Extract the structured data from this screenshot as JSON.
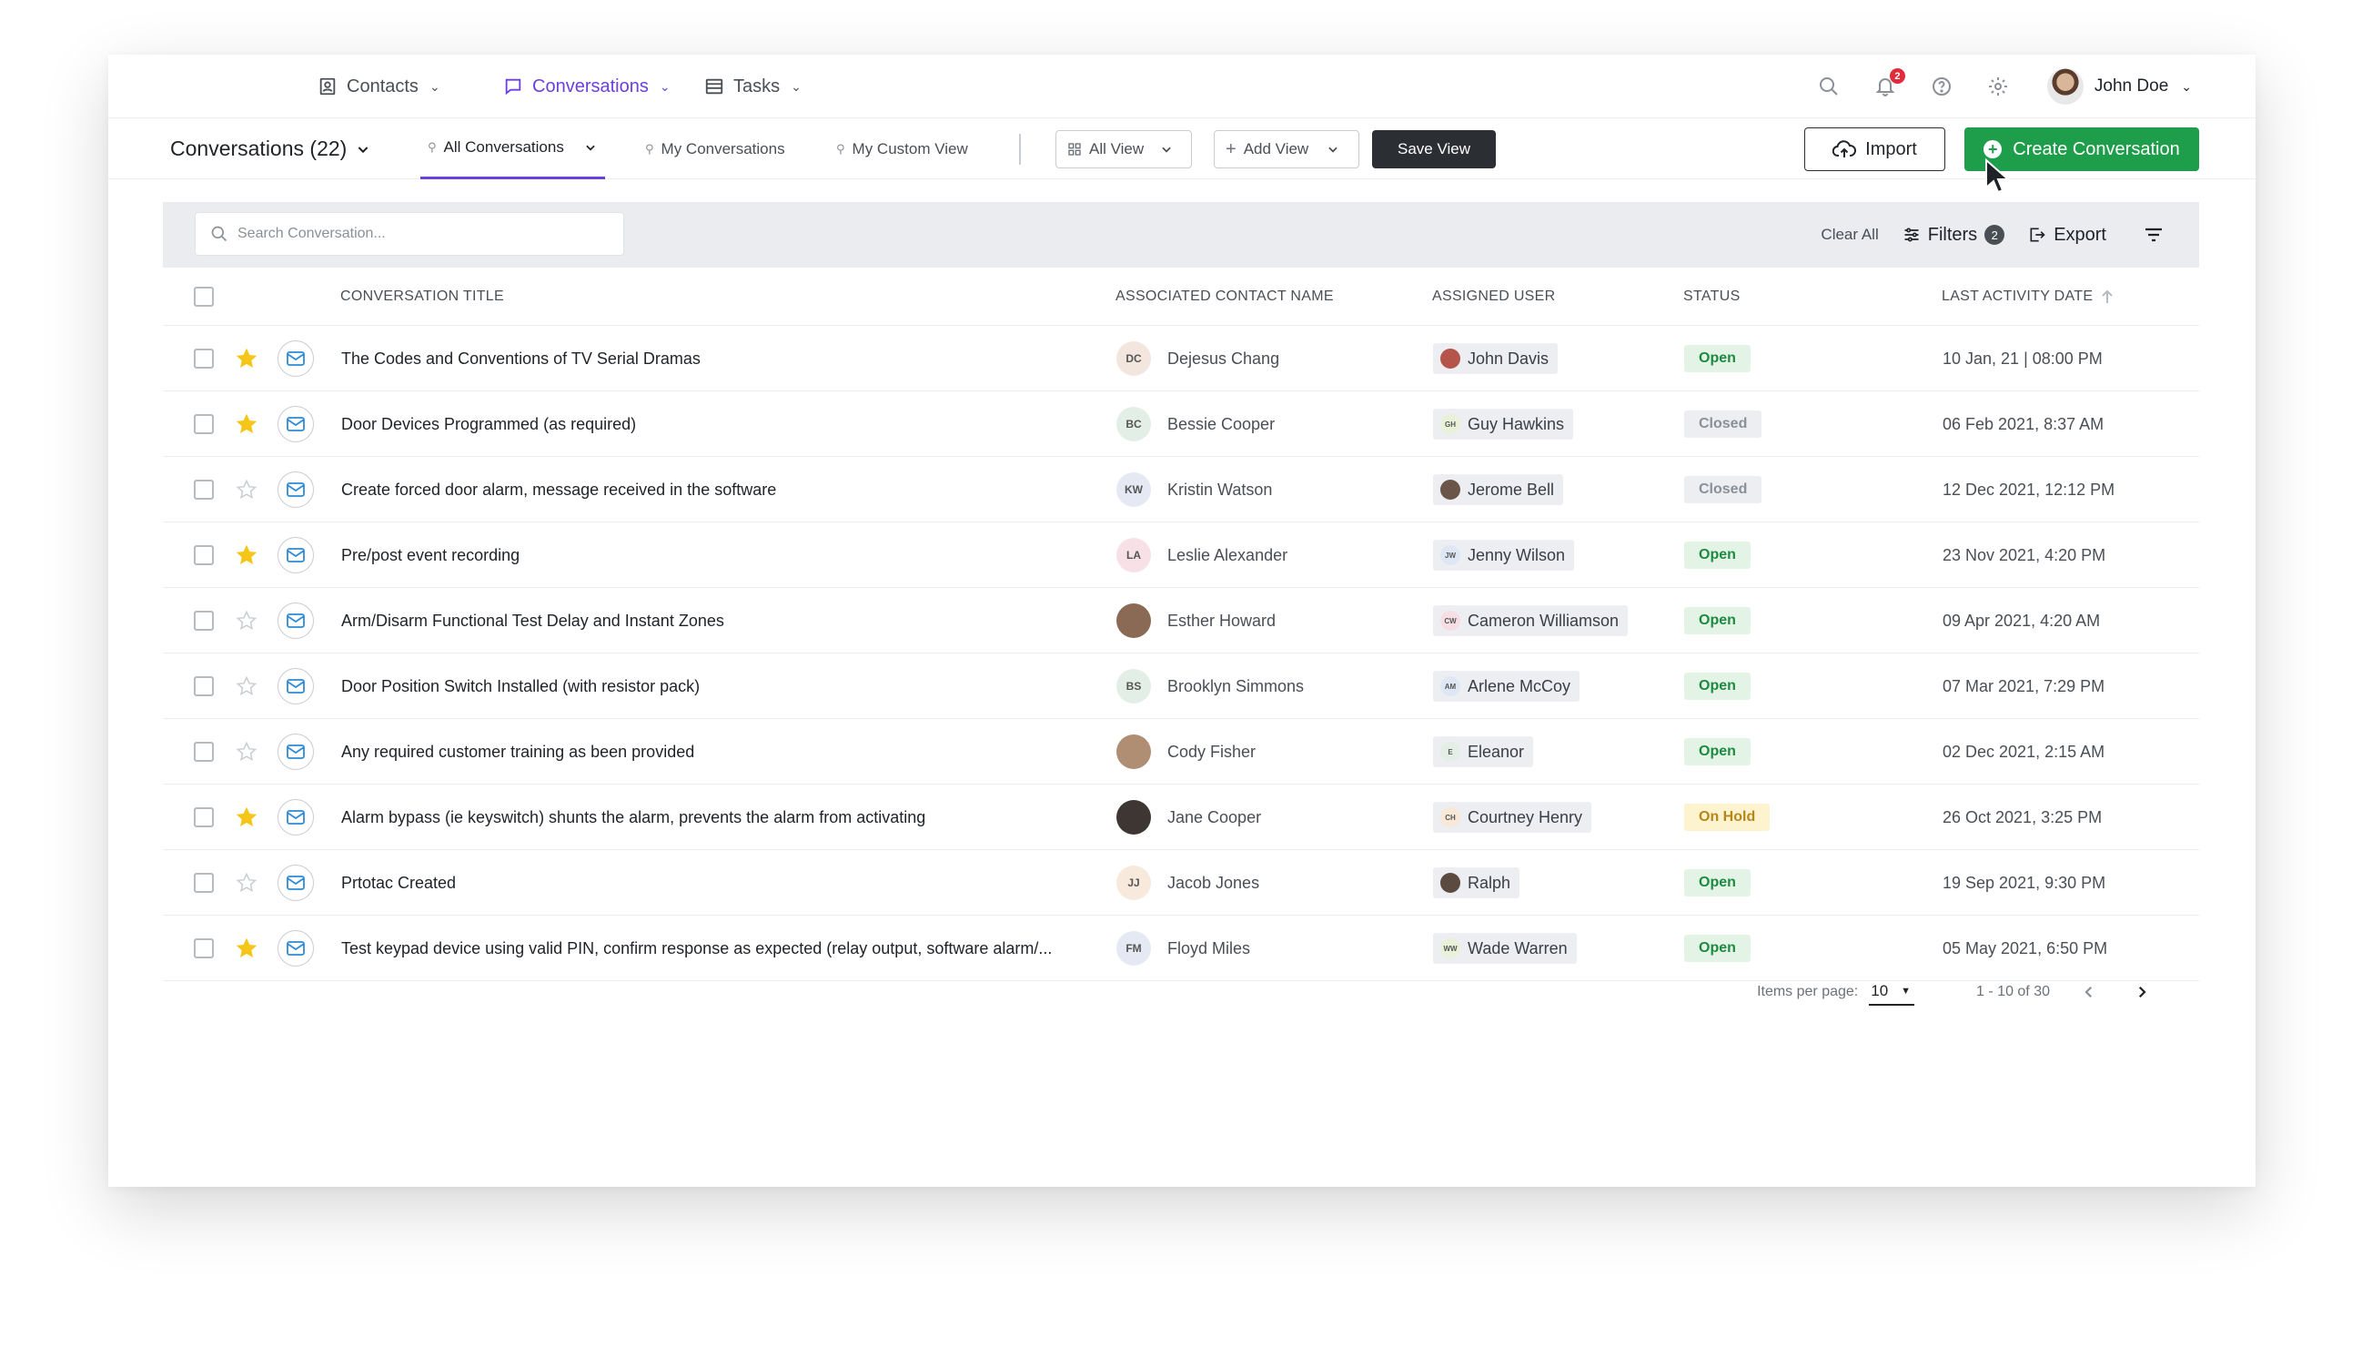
{
  "nav": {
    "items": [
      {
        "label": "Contacts",
        "icon": "contacts-icon",
        "active": false
      },
      {
        "label": "Conversations",
        "icon": "chat-icon",
        "active": true
      },
      {
        "label": "Tasks",
        "icon": "tasks-icon",
        "active": false
      }
    ],
    "notification_count": "2",
    "user_name": "John Doe"
  },
  "subheader": {
    "title": "Conversations (22)",
    "tabs": [
      {
        "label": "All Conversations",
        "active": true
      },
      {
        "label": "My Conversations",
        "active": false
      },
      {
        "label": "My Custom View",
        "active": false
      }
    ],
    "all_view_label": "All View",
    "add_view_label": "Add View",
    "save_view_label": "Save View",
    "import_label": "Import",
    "create_label": "Create Conversation"
  },
  "toolbar": {
    "search_placeholder": "Search Conversation...",
    "clear_all": "Clear All",
    "filters_label": "Filters",
    "filters_count": "2",
    "export_label": "Export"
  },
  "table": {
    "columns": {
      "title": "CONVERSATION TITLE",
      "contact": "ASSOCIATED CONTACT NAME",
      "user": "ASSIGNED USER",
      "status": "STATUS",
      "date": "LAST ACTIVITY DATE"
    },
    "rows": [
      {
        "starred": true,
        "title": "The Codes and Conventions of TV Serial Dramas",
        "contact_initials": "DC",
        "contact": "Dejesus Chang",
        "contact_avatar_color": "#f3e6df",
        "user_initials": "",
        "user": "John Davis",
        "user_avatar_color": "#b5544a",
        "status": "Open",
        "date": "10 Jan, 21 | 08:00 PM"
      },
      {
        "starred": true,
        "title": "Door Devices Programmed (as required)",
        "contact_initials": "BC",
        "contact": "Bessie Cooper",
        "contact_avatar_color": "#e3efe6",
        "user_initials": "GH",
        "user": "Guy Hawkins",
        "user_avatar_color": "#e9f1d9",
        "status": "Closed",
        "date": "06 Feb 2021, 8:37 AM"
      },
      {
        "starred": false,
        "title": "Create forced door alarm, message received in the software",
        "contact_initials": "KW",
        "contact": "Kristin Watson",
        "contact_avatar_color": "#e4e9f4",
        "user_initials": "",
        "user": "Jerome Bell",
        "user_avatar_color": "#6a5548",
        "status": "Closed",
        "date": "12 Dec 2021, 12:12 PM"
      },
      {
        "starred": true,
        "title": "Pre/post event recording",
        "contact_initials": "LA",
        "contact": "Leslie Alexander",
        "contact_avatar_color": "#f7e1e6",
        "user_initials": "JW",
        "user": "Jenny Wilson",
        "user_avatar_color": "#dfe6f4",
        "status": "Open",
        "date": "23 Nov 2021, 4:20 PM"
      },
      {
        "starred": false,
        "title": "Arm/Disarm Functional Test Delay and Instant Zones",
        "contact_initials": "",
        "contact": "Esther Howard",
        "contact_avatar_color": "#8a6a55",
        "user_initials": "CW",
        "user": "Cameron Williamson",
        "user_avatar_color": "#f6dfe4",
        "status": "Open",
        "date": "09 Apr 2021, 4:20 AM"
      },
      {
        "starred": false,
        "title": "Door Position Switch Installed (with resistor pack)",
        "contact_initials": "BS",
        "contact": "Brooklyn Simmons",
        "contact_avatar_color": "#e3efe6",
        "user_initials": "AM",
        "user": "Arlene McCoy",
        "user_avatar_color": "#dfe6f4",
        "status": "Open",
        "date": "07 Mar 2021, 7:29 PM"
      },
      {
        "starred": false,
        "title": "Any required customer training as been provided",
        "contact_initials": "",
        "contact": "Cody Fisher",
        "contact_avatar_color": "#b08e74",
        "user_initials": "E",
        "user": "Eleanor",
        "user_avatar_color": "#e3efe6",
        "status": "Open",
        "date": "02 Dec 2021, 2:15 AM"
      },
      {
        "starred": true,
        "title": "Alarm bypass (ie keyswitch) shunts the alarm, prevents the alarm from activating",
        "contact_initials": "",
        "contact": "Jane Cooper",
        "contact_avatar_color": "#3d3633",
        "user_initials": "CH",
        "user": "Courtney Henry",
        "user_avatar_color": "#f7e8d8",
        "status": "On Hold",
        "date": "26 Oct 2021, 3:25 PM"
      },
      {
        "starred": false,
        "title": "Prtotac Created",
        "contact_initials": "JJ",
        "contact": "Jacob Jones",
        "contact_avatar_color": "#f7e9dc",
        "user_initials": "",
        "user": "Ralph",
        "user_avatar_color": "#5b4a3f",
        "status": "Open",
        "date": "19 Sep 2021, 9:30 PM"
      },
      {
        "starred": true,
        "title": "Test keypad device using valid PIN, confirm response as expected (relay output, software alarm/...",
        "contact_initials": "FM",
        "contact": "Floyd Miles",
        "contact_avatar_color": "#e4e9f4",
        "user_initials": "WW",
        "user": "Wade Warren",
        "user_avatar_color": "#e9f1d9",
        "status": "Open",
        "date": "05 May 2021, 6:50 PM"
      }
    ]
  },
  "pagination": {
    "items_per_page_label": "Items per page:",
    "items_per_page": "10",
    "range": "1 - 10 of 30"
  },
  "colors": {
    "accent": "#6c3fe0",
    "create_green": "#1e9e4a",
    "star": "#f5c518",
    "status_open_bg": "#e3f4e7",
    "status_open_fg": "#1e8a3f",
    "status_closed_bg": "#eceef1",
    "status_closed_fg": "#8a9097",
    "status_hold_bg": "#fdf3cf",
    "status_hold_fg": "#b7861a"
  }
}
